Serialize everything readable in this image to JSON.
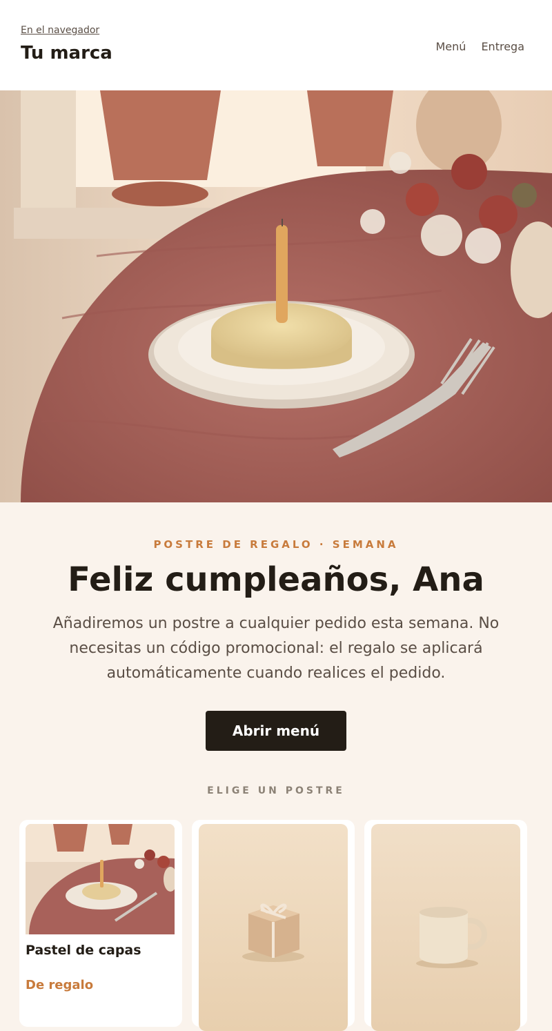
{
  "header": {
    "browser_link": "En el navegador",
    "brand": "Tu marca",
    "nav": [
      "Menú",
      "Entrega"
    ]
  },
  "hero": {
    "image": "birthday-cake-candle-table-photo"
  },
  "content": {
    "eyebrow": "POSTRE DE REGALO · SEMANA",
    "headline": "Feliz cumpleaños, Ana",
    "body": "Añadiremos un postre a cualquier pedido esta semana. No necesitas un código promocional: el regalo se aplicará automáticamente cuando realices el pedido.",
    "cta": "Abrir menú",
    "section_label": "ELIGE UN POSTRE"
  },
  "cards": [
    {
      "title": "Pastel de capas",
      "badge": "De regalo",
      "image": "cake-photo"
    },
    {
      "image": "gift-box-photo"
    },
    {
      "image": "mug-photo"
    }
  ],
  "colors": {
    "accent": "#c87b3c",
    "dark": "#231d16",
    "background": "#faf3ec",
    "tablecloth": "#a8615a"
  }
}
